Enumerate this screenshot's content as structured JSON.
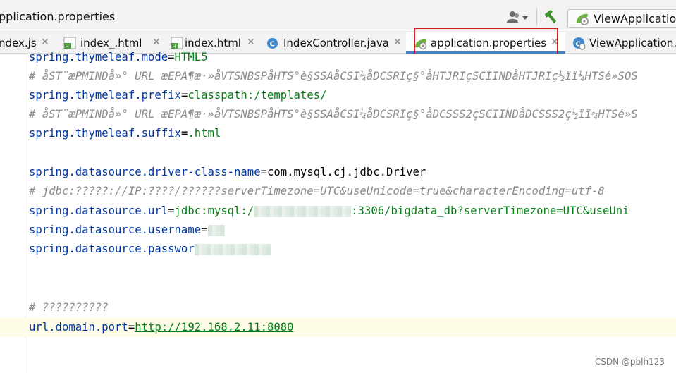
{
  "breadcrumb": "pplication.properties",
  "toolbar": {
    "run_config_label": "ViewApplication"
  },
  "tabs": [
    {
      "label": "ndex.js",
      "icon": "js-file-icon"
    },
    {
      "label": "index_.html",
      "icon": "html-file-icon"
    },
    {
      "label": "index.html",
      "icon": "html-file-icon"
    },
    {
      "label": "IndexController.java",
      "icon": "java-class-icon"
    },
    {
      "label": "application.properties",
      "icon": "spring-properties-icon",
      "active": true
    },
    {
      "label": "ViewApplication.",
      "icon": "spring-class-icon"
    }
  ],
  "editor": {
    "lines": [
      {
        "key": "spring.thymeleaf.mode",
        "value": "HTML5"
      },
      {
        "comment": "# åST¨æPMINDå»° URL æEPA¶æ·»åVTSNBSPåHTS°è§SSAåCSI¼åDCSRIç§°åHTJRIçSCIINDåHTJRIç½ïï¼HTSé»SOS"
      },
      {
        "key": "spring.thymeleaf.prefix",
        "value": "classpath:/templates/"
      },
      {
        "comment": "# åST¨æPMINDå»° URL æEPA¶æ·»åVTSNBSPåHTS°è§SSAåCSI¼åDCSRIç§°åDCSSS2çSCIINDåDCSSS2ç½ïï¼HTSé»S"
      },
      {
        "key": "spring.thymeleaf.suffix",
        "value": ".html"
      },
      {
        "empty": true
      },
      {
        "key": "spring.datasource.driver-class-name",
        "value": "com.mysql.cj.jdbc.Driver"
      },
      {
        "comment": "# jdbc:?????://IP:????/??????serverTimezone=UTC&useUnicode=true&characterEncoding=utf-8"
      },
      {
        "key": "spring.datasource.url",
        "value_prefix": "jdbc:mysql:/",
        "value_suffix": ":3306/bigdata_db?serverTimezone=UTC&useUni"
      },
      {
        "key": "spring.datasource.username",
        "value": ""
      },
      {
        "key": "spring.datasource.passwor",
        "value": ""
      },
      {
        "empty": true
      },
      {
        "empty": true
      },
      {
        "comment": "# ??????????"
      },
      {
        "key": "url.domain.port",
        "value": "http://192.168.2.11:8080"
      }
    ]
  },
  "watermark": "CSDN @pblh123"
}
